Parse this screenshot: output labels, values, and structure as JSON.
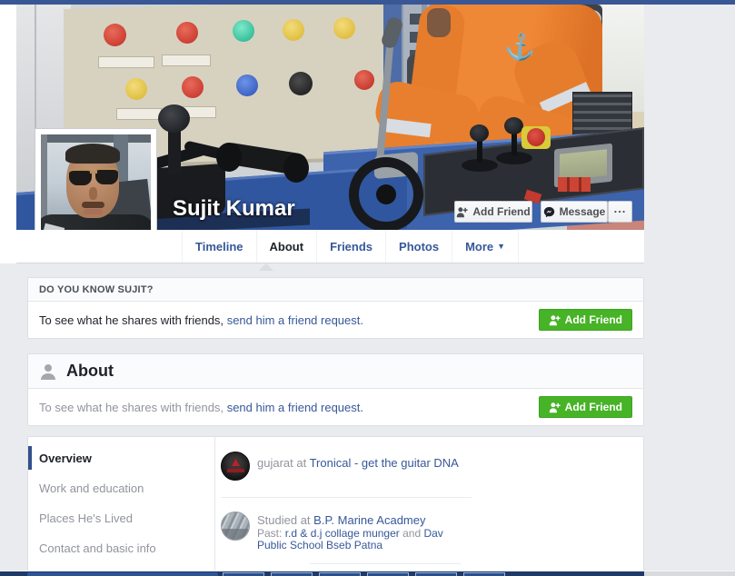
{
  "profile": {
    "name": "Sujit Kumar"
  },
  "cover_buttons": {
    "add_friend": "Add Friend",
    "message": "Message",
    "more": "..."
  },
  "tabs": [
    {
      "label": "Timeline",
      "active": false
    },
    {
      "label": "About",
      "active": true
    },
    {
      "label": "Friends",
      "active": false
    },
    {
      "label": "Photos",
      "active": false
    },
    {
      "label": "More",
      "active": false
    }
  ],
  "know_card": {
    "header": "DO YOU KNOW SUJIT?",
    "text_plain": "To see what he shares with friends,",
    "text_link": "send him a friend request.",
    "button": "Add Friend"
  },
  "about_card": {
    "title": "About",
    "text_plain": "To see what he shares with friends,",
    "text_link": "send him a friend request.",
    "button": "Add Friend"
  },
  "about_nav": [
    "Overview",
    "Work and education",
    "Places He's Lived",
    "Contact and basic info"
  ],
  "work_entry": {
    "prefix": "gujarat at ",
    "employer": "Tronical - get the guitar DNA"
  },
  "education_entry": {
    "prefix": "Studied at ",
    "school": "B.P. Marine Acadmey",
    "past_label": "Past: ",
    "past_link1": "r.d & d.j collage munger",
    "past_and": " and ",
    "past_link2": "Dav Public School Bseb Patna"
  },
  "icons": {
    "add_friend": "person-plus",
    "message": "messenger-bubble",
    "more": "ellipsis",
    "about_header": "person-silhouette",
    "work": "tronical-logo",
    "education": "building-photo"
  },
  "colors": {
    "fb_blue": "#3a5795",
    "link_blue": "#365899",
    "green_button": "#42b72a",
    "page_bg": "#e9ebee",
    "active_text": "#1d2129",
    "muted_text": "#90949c"
  }
}
